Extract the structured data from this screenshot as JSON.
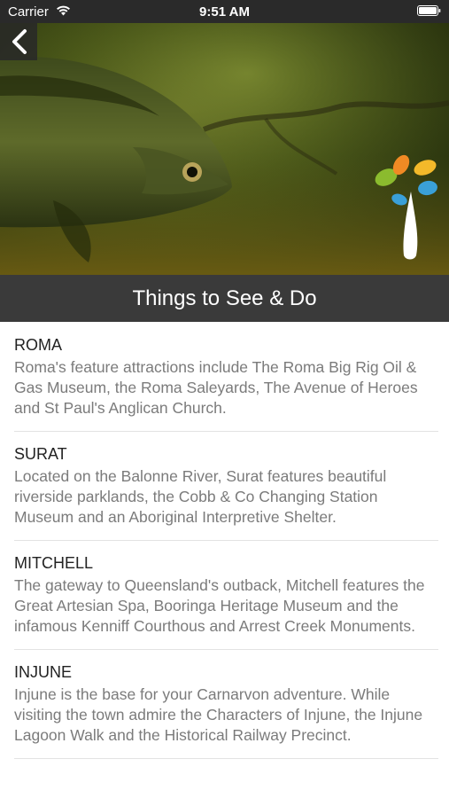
{
  "status_bar": {
    "carrier": "Carrier",
    "time": "9:51 AM"
  },
  "header": {
    "back_icon": "chevron-left-icon",
    "title": "Things to See & Do"
  },
  "colors": {
    "title_bar": "#3a3a3a",
    "status_bar": "#2a2a2a",
    "item_title": "#222222",
    "item_desc": "#7b7b7b",
    "logo_orange": "#f08a24",
    "logo_green": "#8bbb2e",
    "logo_blue": "#3aa0d8",
    "logo_yellow": "#f3b92a"
  },
  "items": [
    {
      "title": "ROMA",
      "description": "Roma's feature attractions include The Roma Big Rig Oil & Gas Museum, the Roma Saleyards, The Avenue of Heroes and St Paul's Anglican Church."
    },
    {
      "title": "SURAT",
      "description": "Located on the Balonne River, Surat features beautiful riverside parklands, the Cobb & Co Changing Station Museum and an Aboriginal Interpretive Shelter."
    },
    {
      "title": "MITCHELL",
      "description": "The gateway to Queensland's outback, Mitchell features the Great Artesian Spa, Booringa Heritage Museum and the infamous Kenniff Courthous and Arrest Creek Monuments."
    },
    {
      "title": "INJUNE",
      "description": "Injune is the base for your Carnarvon adventure. While visiting the town admire the Characters of Injune, the Injune Lagoon Walk and the Historical Railway Precinct."
    }
  ]
}
